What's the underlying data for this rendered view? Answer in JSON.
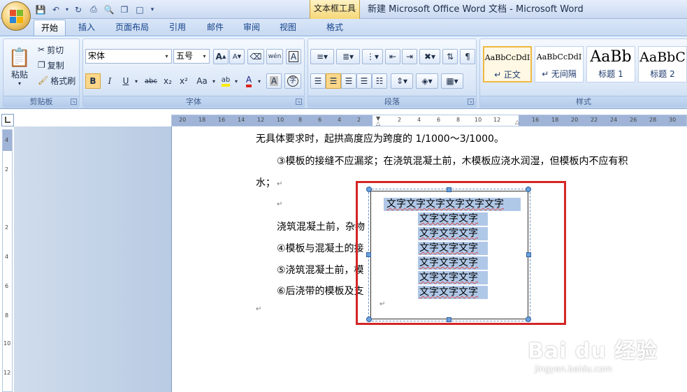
{
  "titlebar": {
    "context_tool_group": "文本框工具",
    "window_title": "新建 Microsoft Office Word 文档 - Microsoft Word"
  },
  "ribbon_tabs": [
    "开始",
    "插入",
    "页面布局",
    "引用",
    "邮件",
    "审阅",
    "视图",
    "格式"
  ],
  "active_tab": "开始",
  "clipboard": {
    "paste": "粘贴",
    "cut": "剪切",
    "copy": "复制",
    "format_painter": "格式刷",
    "group_label": "剪贴板"
  },
  "font": {
    "font_name": "宋体",
    "font_size": "五号",
    "group_label": "字体",
    "bold": "B",
    "italic": "I",
    "underline": "U",
    "strikethrough": "abc",
    "subscript": "x₂",
    "superscript": "x²",
    "change_case": "Aa",
    "grow_font": "A",
    "shrink_font": "A",
    "char_shade": "A",
    "font_color": "A",
    "phonetic": "wén"
  },
  "paragraph": {
    "group_label": "段落"
  },
  "styles": {
    "group_label": "样式",
    "tiles": [
      {
        "sample": "AaBbCcDdI",
        "name": "↵ 正文"
      },
      {
        "sample": "AaBbCcDdI",
        "name": "↵ 无间隔"
      },
      {
        "sample": "AaBb",
        "name": "标题 1"
      },
      {
        "sample": "AaBbC",
        "name": "标题 2"
      }
    ]
  },
  "ruler": {
    "h_ticks_left": [
      "20",
      "18",
      "16",
      "14",
      "12",
      "10",
      "8",
      "6",
      "4",
      "2"
    ],
    "h_ticks_right": [
      "2",
      "4",
      "6",
      "8",
      "10",
      "12"
    ],
    "h_ticks_far": [
      "16",
      "18",
      "20",
      "22",
      "24",
      "26",
      "28",
      "30"
    ],
    "v_ticks": [
      "4",
      "2",
      "2",
      "4",
      "6",
      "8",
      "10",
      "12"
    ]
  },
  "document": {
    "line1": "无具体要求时，起拱高度应为跨度的 1/1000～3/1000。",
    "line2": "③模板的接缝不应漏浆；在浇筑混凝土前，木模板应浇水润湿，但模板内不应有积",
    "line3": "水；",
    "line4": "浇筑混凝土前，杂物",
    "line5": "④模板与混凝土的接",
    "line6": "⑤浇筑混凝土前，模",
    "line7": "⑥后浇带的模板及支",
    "para_mark": "↵"
  },
  "textbox": {
    "lines": [
      "文字文字文字文字文字文字",
      "文字文字文字",
      "文字文字文字",
      "文字文字文字",
      "文字文字文字",
      "文字文字文字",
      "文字文字文字"
    ]
  },
  "watermark": {
    "brand": "Bai du 经验",
    "url": "jingyan.baidu.com"
  }
}
